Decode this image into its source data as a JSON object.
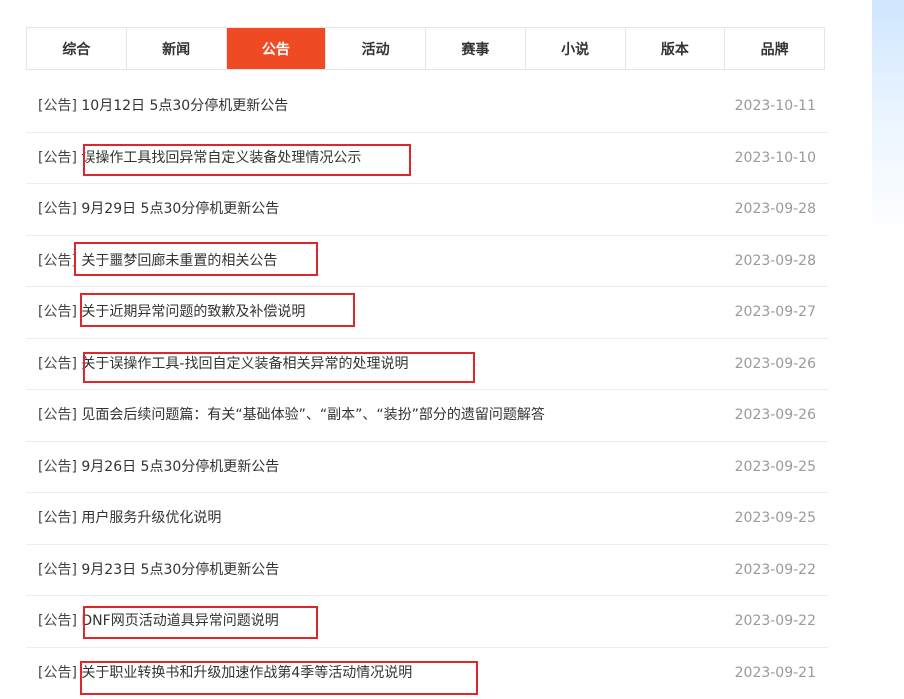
{
  "tabs": [
    {
      "label": "综合",
      "active": false
    },
    {
      "label": "新闻",
      "active": false
    },
    {
      "label": "公告",
      "active": true
    },
    {
      "label": "活动",
      "active": false
    },
    {
      "label": "赛事",
      "active": false
    },
    {
      "label": "小说",
      "active": false
    },
    {
      "label": "版本",
      "active": false
    },
    {
      "label": "品牌",
      "active": false
    }
  ],
  "items": [
    {
      "category": "[公告]",
      "title": "10月12日 5点30分停机更新公告",
      "date": "2023-10-11"
    },
    {
      "category": "[公告]",
      "title": "误操作工具找回异常自定义装备处理情况公示",
      "date": "2023-10-10"
    },
    {
      "category": "[公告]",
      "title": "9月29日 5点30分停机更新公告",
      "date": "2023-09-28"
    },
    {
      "category": "[公告]",
      "title": "关于噩梦回廊未重置的相关公告",
      "date": "2023-09-28"
    },
    {
      "category": "[公告]",
      "title": "关于近期异常问题的致歉及补偿说明",
      "date": "2023-09-27"
    },
    {
      "category": "[公告]",
      "title": "关于误操作工具-找回自定义装备相关异常的处理说明",
      "date": "2023-09-26"
    },
    {
      "category": "[公告]",
      "title": "见面会后续问题篇：有关“基础体验”、“副本”、“装扮”部分的遗留问题解答",
      "date": "2023-09-26"
    },
    {
      "category": "[公告]",
      "title": "9月26日 5点30分停机更新公告",
      "date": "2023-09-25"
    },
    {
      "category": "[公告]",
      "title": "用户服务升级优化说明",
      "date": "2023-09-25"
    },
    {
      "category": "[公告]",
      "title": "9月23日 5点30分停机更新公告",
      "date": "2023-09-22"
    },
    {
      "category": "[公告]",
      "title": "DNF网页活动道具异常问题说明",
      "date": "2023-09-22"
    },
    {
      "category": "[公告]",
      "title": "关于职业转换书和升级加速作战第4季等活动情况说明",
      "date": "2023-09-21"
    }
  ],
  "colors": {
    "active_tab": "#f04a24",
    "highlight_box": "#e0262d",
    "date_text": "#9a9a9a"
  }
}
